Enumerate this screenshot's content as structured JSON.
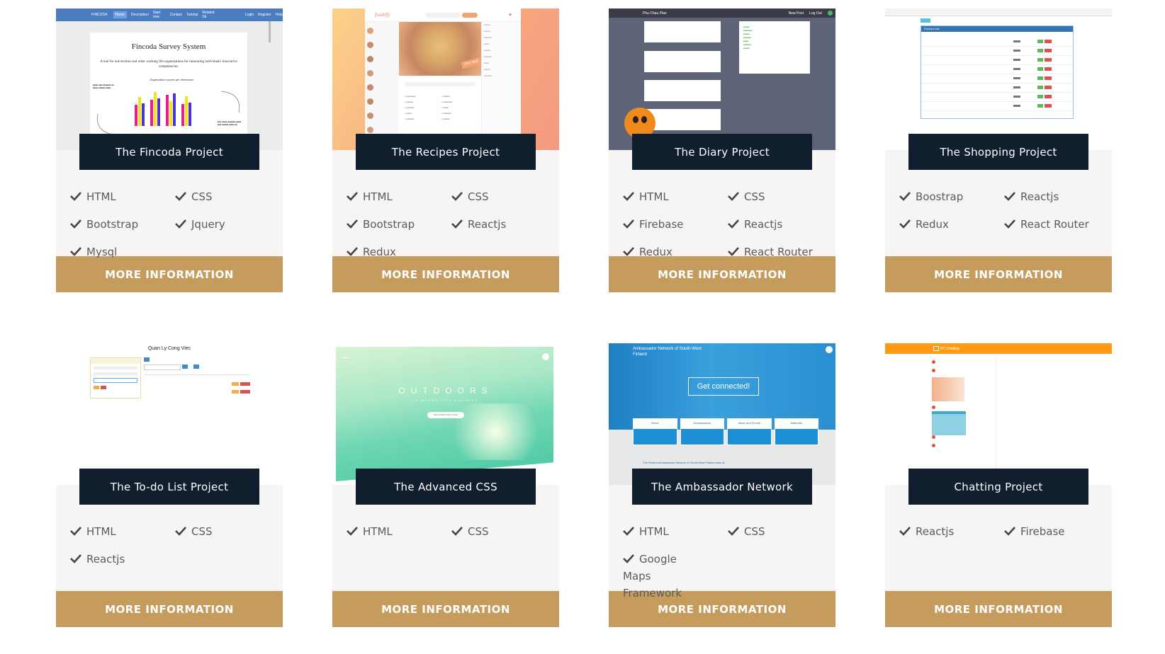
{
  "button_label": "MORE INFORMATION",
  "accent_color": "#c69b5e",
  "title_bg": "#111e2e",
  "projects": [
    {
      "title": "The Fincoda Project",
      "techs": [
        "HTML",
        "CSS",
        "Bootstrap",
        "Jquery",
        "Mysql"
      ],
      "thumb": {
        "nav_brand": "FINCODA",
        "nav_items": [
          "Home",
          "Description",
          "Start now",
          "Contact",
          "Tutorial",
          "Related Sit"
        ],
        "nav_right": [
          "Login",
          "Register",
          "Help"
        ],
        "heading": "Fincoda Survey System",
        "subheading": "A tool for universities and other working life organizations for measuring individuals' innovative competencies.",
        "chart_title": "Organization scores per dimension"
      }
    },
    {
      "title": "The Recipes Project",
      "techs": [
        "HTML",
        "CSS",
        "Bootstrap",
        "Reactjs",
        "Redux"
      ],
      "thumb": {
        "brand": "foodify",
        "badge": "TRY PAD"
      }
    },
    {
      "title": "The Diary Project",
      "techs": [
        "HTML",
        "CSS",
        "Firebase",
        "Reactjs",
        "Redux",
        "React Router"
      ],
      "thumb": {
        "header": "Phu Chau Plan",
        "header_right": [
          "New Post",
          "Log Out"
        ]
      }
    },
    {
      "title": "The Shopping Project",
      "techs": [
        "Boostrap",
        "Reactjs",
        "Redux",
        "React Router"
      ],
      "thumb": {
        "panel_title": "Product List"
      }
    },
    {
      "title": "The To-do List Project",
      "techs": [
        "HTML",
        "CSS",
        "Reactjs"
      ],
      "thumb": {
        "heading": "Quan Ly Cong Viec"
      }
    },
    {
      "title": "The Advanced CSS",
      "techs": [
        "HTML",
        "CSS"
      ],
      "thumb": {
        "heading": "OUTDOORS",
        "subheading": "IS WHERE LIFE HAPPENS",
        "cta": "DISCOVER OUR TOURS"
      }
    },
    {
      "title": "The Ambassador Network",
      "techs": [
        "HTML",
        "CSS",
        "Google Maps Framework"
      ],
      "thumb": {
        "brand": "Ambassador Network of South-West Finland",
        "cta": "Get connected!",
        "tabs": [
          "About",
          "Ambassadors",
          "News And Events",
          "Materials"
        ],
        "footer_text": "The Student Ambassador Network of South-West Finland aims at"
      }
    },
    {
      "title": "Chatting Project",
      "techs": [
        "Reactjs",
        "Firebase"
      ],
      "thumb": {
        "brand": "PC Chatting"
      }
    }
  ]
}
